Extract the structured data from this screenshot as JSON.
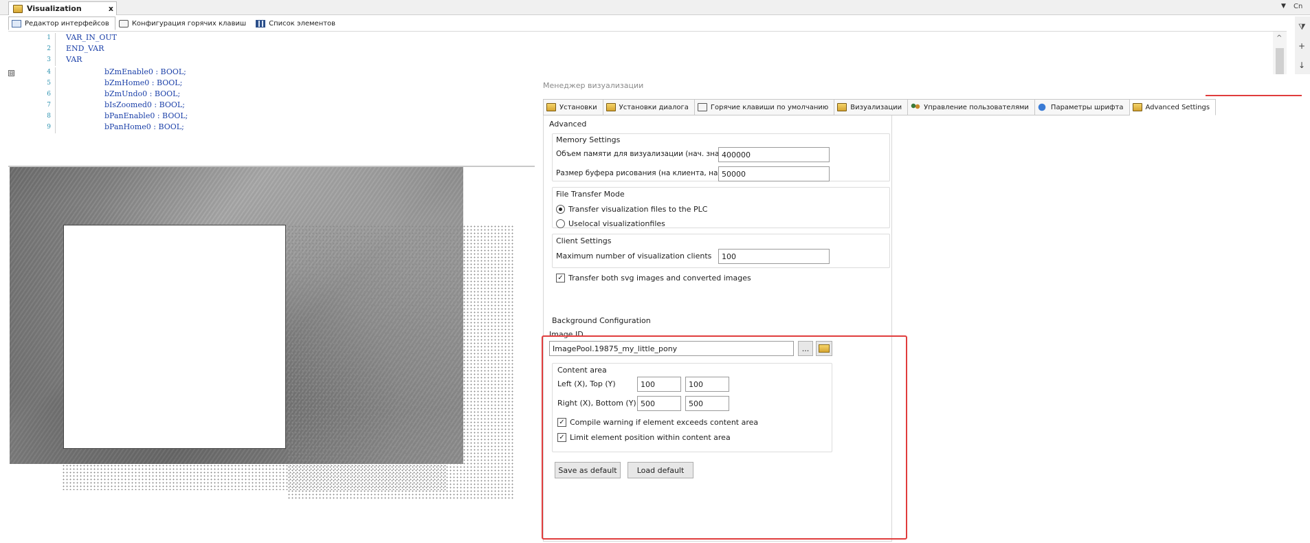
{
  "document_tab": {
    "title": "Visualization",
    "close": "x"
  },
  "editor_views": [
    {
      "label": "Редактор интерфейсов"
    },
    {
      "label": "Конфигурация горячих клавиш"
    },
    {
      "label": "Список элементов"
    }
  ],
  "code": {
    "lines": [
      {
        "num": "1",
        "text": "VAR_IN_OUT"
      },
      {
        "num": "2",
        "text": "END_VAR"
      },
      {
        "num": "3",
        "text": "VAR"
      },
      {
        "num": "4",
        "text": "bZmEnable0 : BOOL;"
      },
      {
        "num": "5",
        "text": "bZmHome0 : BOOL;"
      },
      {
        "num": "6",
        "text": "bZmUndo0 : BOOL;"
      },
      {
        "num": "7",
        "text": "bIsZoomed0 : BOOL;"
      },
      {
        "num": "8",
        "text": "bPanEnable0 : BOOL;"
      },
      {
        "num": "9",
        "text": "bPanHome0 : BOOL;"
      }
    ],
    "fold_marker": "⊟"
  },
  "strip_right_label": "Cn",
  "manager": {
    "title": "Менеджер визуализации",
    "tabs": [
      {
        "label": "Установки",
        "icon": "settings-icon"
      },
      {
        "label": "Установки диалога",
        "icon": "dialog-settings-icon"
      },
      {
        "label": "Горячие клавиши по умолчанию",
        "icon": "keyboard-icon"
      },
      {
        "label": "Визуализации",
        "icon": "visualization-icon"
      },
      {
        "label": "Управление пользователями",
        "icon": "users-icon"
      },
      {
        "label": "Параметры шрифта",
        "icon": "font-icon"
      },
      {
        "label": "Advanced Settings",
        "icon": "advanced-settings-icon"
      }
    ],
    "active_tab": "Advanced Settings",
    "advanced": {
      "heading": "Advanced",
      "memory": {
        "title": "Memory Settings",
        "mem_label": "Объем памяти для визуализации (нач. значе",
        "mem_value": "400000",
        "buffer_label": "Размер буфера рисования (на клиента, нач. з",
        "buffer_value": "50000"
      },
      "file_transfer": {
        "title": "File Transfer Mode",
        "option1": "Transfer visualization files to the PLC",
        "option2": "Uselocal visualizationfiles",
        "selected": 1
      },
      "client": {
        "title": "Client Settings",
        "max_clients_label": "Maximum number of visualization clients",
        "max_clients_value": "100"
      },
      "transfer_svg": {
        "label": "Transfer both svg images and converted images",
        "checked": true
      }
    },
    "background": {
      "title": "Background Configuration",
      "image_id_label": "Image ID",
      "image_id_value": "ImagePool.19875_my_little_pony",
      "browse_label": "...",
      "content_area": {
        "title": "Content area",
        "left_top_label": "Left (X), Top (Y)",
        "left": "100",
        "top": "100",
        "right_bottom_label": "Right (X), Bottom (Y)",
        "right": "500",
        "bottom": "500"
      },
      "compile_warning": {
        "label": "Compile warning if element exceeds content area",
        "checked": true
      },
      "limit_position": {
        "label": "Limit element position within content area",
        "checked": true
      }
    },
    "buttons": {
      "save_default": "Save as default",
      "load_default": "Load default"
    }
  },
  "colors": {
    "highlight": "#e03c3c",
    "code_keyword": "#1a3fa8",
    "line_number": "#2b91af"
  }
}
